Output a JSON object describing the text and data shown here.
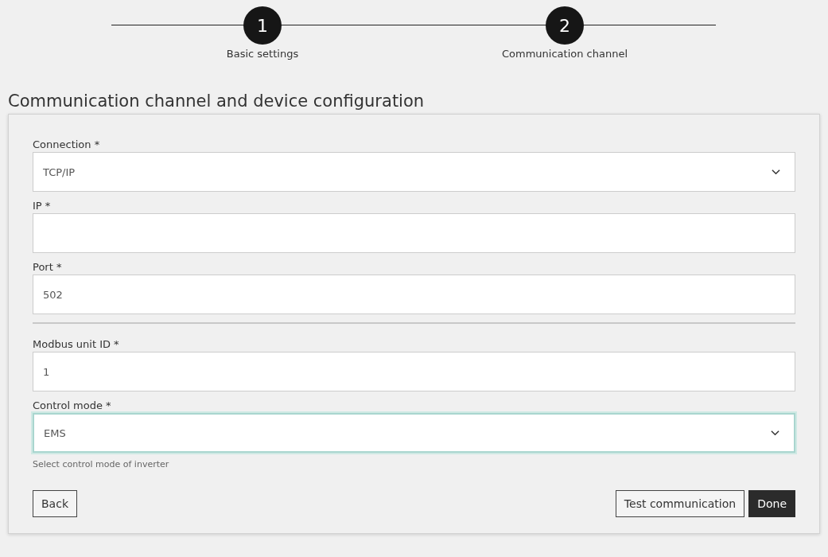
{
  "steps": [
    {
      "number": "1",
      "label": "Basic settings"
    },
    {
      "number": "2",
      "label": "Communication channel"
    }
  ],
  "title": "Communication channel and device configuration",
  "sections": [
    {
      "fields": [
        {
          "kind": "select",
          "label": "Connection *",
          "value": "TCP/IP",
          "focused": false
        },
        {
          "kind": "input",
          "label": "IP *",
          "focused": false
        },
        {
          "kind": "input",
          "label": "Port *",
          "value": "502",
          "focused": false
        }
      ]
    },
    {
      "fields": [
        {
          "kind": "input",
          "label": "Modbus unit ID *",
          "value": "1",
          "focused": false
        },
        {
          "kind": "select",
          "label": "Control mode *",
          "value": "EMS",
          "focused": true,
          "hint": "Select control mode of inverter"
        }
      ]
    }
  ],
  "buttons": {
    "left": [
      {
        "label": "Back",
        "primary": false
      }
    ],
    "right": [
      {
        "label": "Test communication",
        "primary": false
      },
      {
        "label": "Done",
        "primary": true
      }
    ]
  }
}
